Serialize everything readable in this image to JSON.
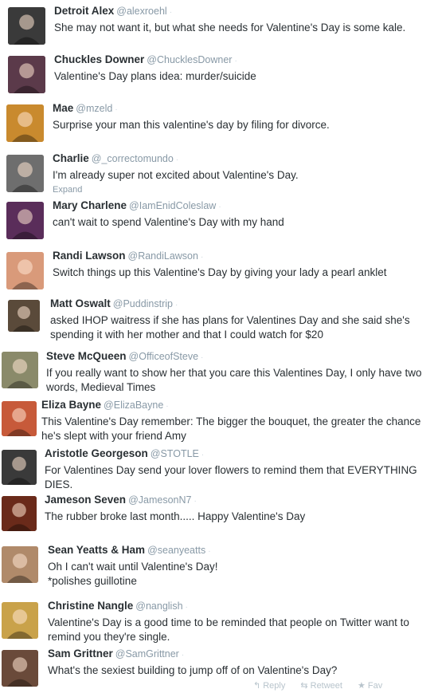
{
  "tweets": [
    {
      "name": "Detroit Alex",
      "handle": "@alexroehl",
      "text": [
        "She may not want it, but what she needs for Valentine's Day is some kale."
      ],
      "avatar_color": "#3a3a3a"
    },
    {
      "name": "Chuckles Downer",
      "handle": "@ChucklesDowner",
      "text": [
        "Valentine's Day plans idea: murder/suicide"
      ],
      "avatar_color": "#5b3a4a"
    },
    {
      "name": "Mae",
      "handle": "@mzeld",
      "text": [
        "Surprise your man this valentine's day by filing for divorce."
      ],
      "avatar_color": "#c98a2e"
    },
    {
      "name": "Charlie",
      "handle": "@_correctomundo",
      "text": [
        "I'm already super not excited about Valentine's Day."
      ],
      "expand": "Expand",
      "avatar_color": "#6e6e6e"
    },
    {
      "name": "Mary Charlene",
      "handle": "@IamEnidColeslaw",
      "text": [
        "can't wait to spend Valentine's Day with my hand"
      ],
      "avatar_color": "#5a2d5a"
    },
    {
      "name": "Randi Lawson",
      "handle": "@RandiLawson",
      "text": [
        "Switch things up this Valentine's Day by giving your lady a pearl anklet"
      ],
      "avatar_color": "#d99a7a"
    },
    {
      "name": "Matt Oswalt",
      "handle": "@Puddinstrip",
      "text": [
        "asked IHOP waitress if she has plans for Valentines Day and she said she's",
        "spending it with her mother and that I could watch for $20"
      ],
      "avatar_color": "#5a4a3a"
    },
    {
      "name": "Steve McQueen",
      "handle": "@OfficeofSteve",
      "text": [
        "If you really want to show her that you care this Valentines Day, I only have two",
        "words, Medieval Times"
      ],
      "avatar_color": "#8a8a6a"
    },
    {
      "name": "Eliza Bayne",
      "handle": "@ElizaBayne",
      "text": [
        "This Valentine's Day remember: The bigger the bouquet, the greater the chance",
        "he's slept with your friend Amy"
      ],
      "avatar_color": "#c75a3a"
    },
    {
      "name": "Aristotle Georgeson",
      "handle": "@STOTLE",
      "text": [
        "For Valentines Day send your lover flowers to remind them that EVERYTHING",
        "DIES."
      ],
      "avatar_color": "#3a3a3a"
    },
    {
      "name": "Jameson Seven",
      "handle": "@JamesonN7",
      "text": [
        "The rubber broke last month..... Happy Valentine's Day"
      ],
      "avatar_color": "#6a2a1a"
    },
    {
      "name": "Sean Yeatts & Ham",
      "handle": "@seanyeatts",
      "text": [
        "Oh I can't wait until Valentine's Day!",
        "*polishes guillotine"
      ],
      "avatar_color": "#b08a6a"
    },
    {
      "name": "Christine Nangle",
      "handle": "@nanglish",
      "text": [
        "Valentine's Day is a good time to be reminded that people on Twitter want to",
        "remind you they're single."
      ],
      "avatar_color": "#c9a24a"
    },
    {
      "name": "Sam Grittner",
      "handle": "@SamGrittner",
      "text": [
        "What's the sexiest building to jump off of on Valentine's Day?"
      ],
      "avatar_color": "#6a4a3a"
    }
  ],
  "actions": {
    "reply": "Reply",
    "retweet": "Retweet",
    "fav": "Fav"
  },
  "separator": "·"
}
